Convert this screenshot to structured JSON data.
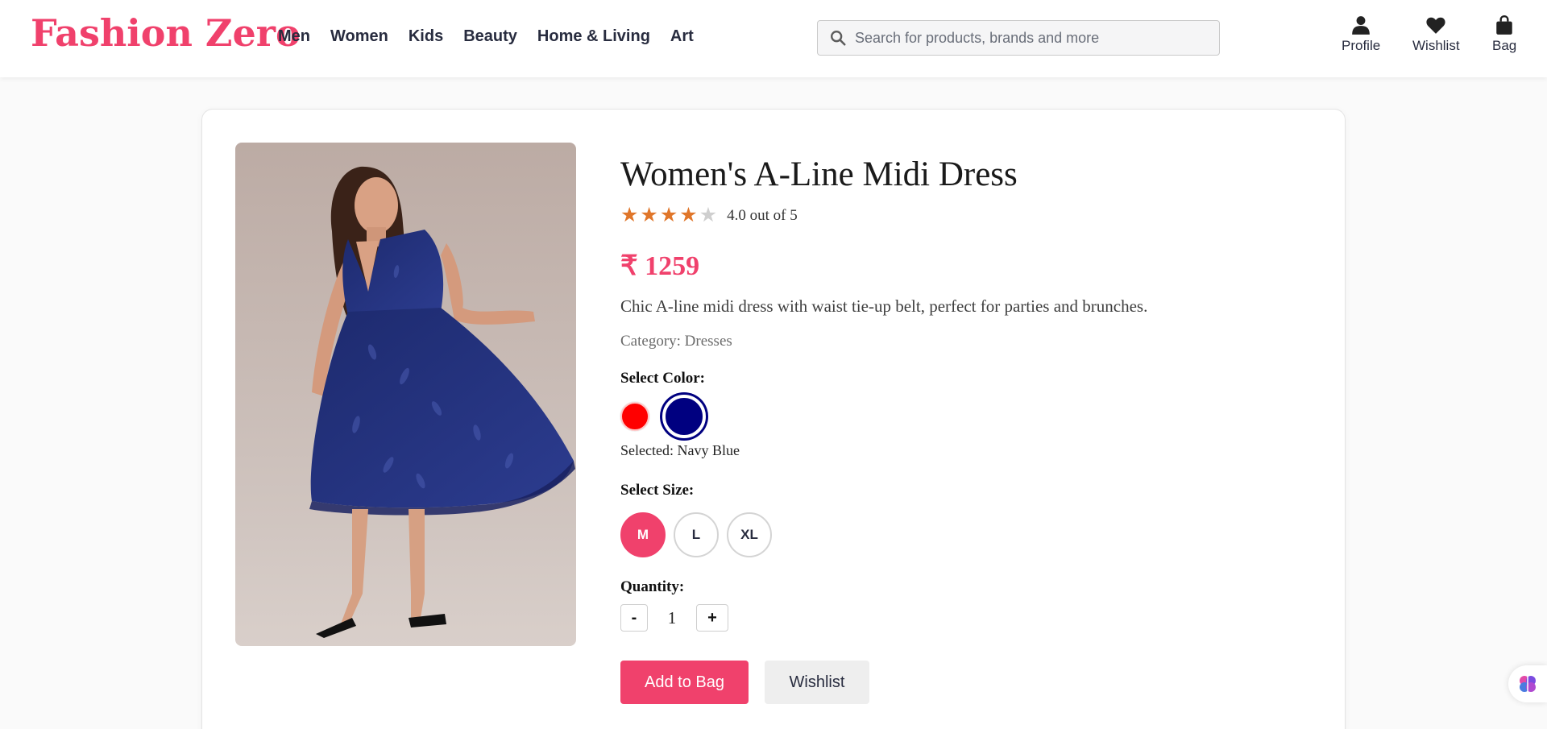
{
  "header": {
    "logo": "Fashion Zero",
    "nav": [
      {
        "label": "Men"
      },
      {
        "label": "Women"
      },
      {
        "label": "Kids"
      },
      {
        "label": "Beauty"
      },
      {
        "label": "Home & Living"
      },
      {
        "label": "Art"
      }
    ],
    "search": {
      "placeholder": "Search for products, brands and more",
      "icon": "search-icon"
    },
    "actions": {
      "profile": {
        "label": "Profile",
        "icon": "person-icon"
      },
      "wishlist": {
        "label": "Wishlist",
        "icon": "heart-icon"
      },
      "bag": {
        "label": "Bag",
        "icon": "shopping-bag-icon"
      }
    }
  },
  "product": {
    "title": "Women's A-Line Midi Dress",
    "rating": {
      "value": 4.0,
      "max": 5,
      "text": "4.0 out of 5"
    },
    "price": "₹ 1259",
    "description": "Chic A-line midi dress with waist tie-up belt, perfect for parties and brunches.",
    "category": "Category: Dresses",
    "color": {
      "label": "Select Color:",
      "options": [
        {
          "name": "Red",
          "hex": "#ff0000"
        },
        {
          "name": "Navy Blue",
          "hex": "#000080"
        }
      ],
      "selected_text": "Selected: Navy Blue"
    },
    "size": {
      "label": "Select Size:",
      "options": [
        "M",
        "L",
        "XL"
      ],
      "selected": "M"
    },
    "quantity": {
      "label": "Quantity:",
      "minus": "-",
      "value": "1",
      "plus": "+"
    },
    "buttons": {
      "add_to_bag": "Add to Bag",
      "wishlist": "Wishlist"
    }
  },
  "colors": {
    "brand": "#f0416c",
    "star": "#e0762a",
    "star_empty": "#cfcfcf",
    "navy": "#000080"
  }
}
